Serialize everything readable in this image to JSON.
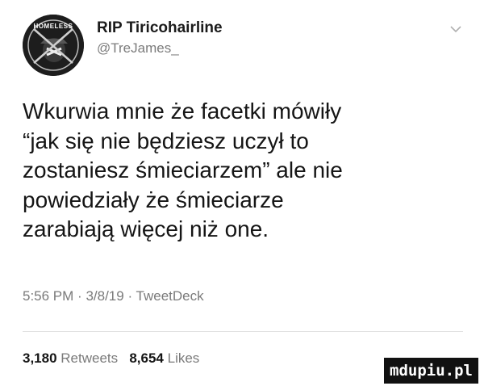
{
  "tweet": {
    "avatar_text": "HOMELESS",
    "display_name": "RIP Tiricohairline",
    "handle": "@TreJames_",
    "text": "Wkurwia mnie że facetki mówiły\n“jak się nie będziesz uczył to\nzostaniesz śmieciarzem” ale nie\npowiedziały że śmieciarze\nzarabiają więcej niż one.",
    "meta": {
      "time": "5:56 PM",
      "date": "3/8/19",
      "source": "TweetDeck",
      "separator": "·"
    },
    "stats": {
      "retweets_count": "3,180",
      "retweets_label": "Retweets",
      "likes_count": "8,654",
      "likes_label": "Likes"
    }
  },
  "watermark": "mdupiu.pl",
  "icons": {
    "avatar": "avatar-image",
    "chevron": "chevron-down-icon"
  }
}
